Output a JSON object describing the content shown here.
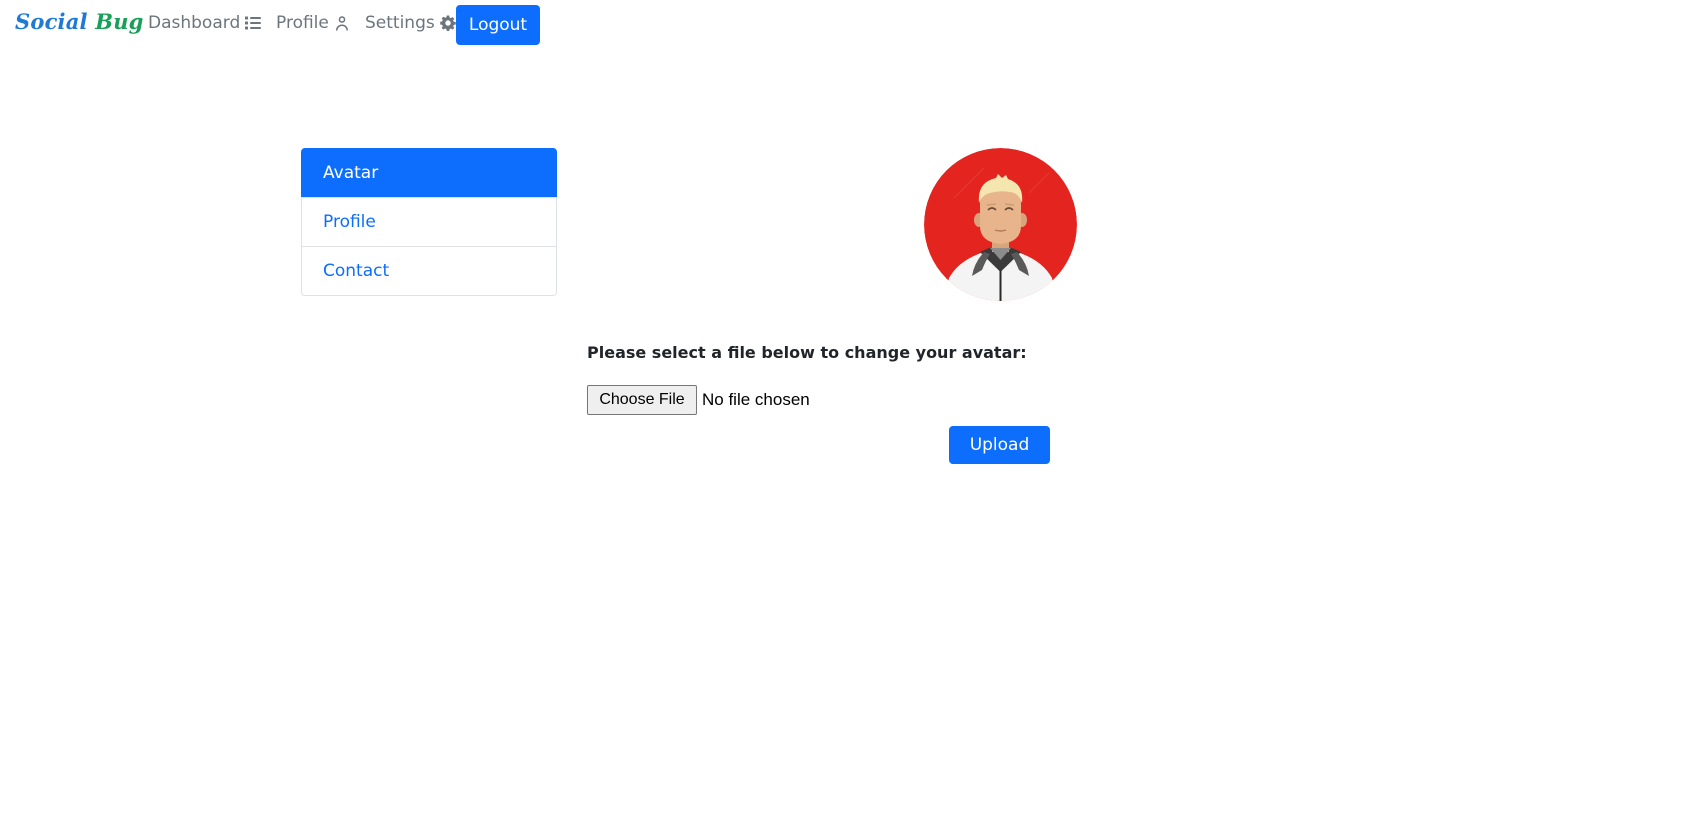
{
  "brand": {
    "part1": "Social",
    "part2": "Bug"
  },
  "nav": {
    "dashboard": {
      "label": "Dashboard",
      "icon": "list-icon"
    },
    "profile": {
      "label": "Profile",
      "icon": "user-icon"
    },
    "settings": {
      "label": "Settings",
      "icon": "gear-icon"
    },
    "logout": "Logout"
  },
  "sidebar": {
    "items": [
      {
        "label": "Avatar",
        "active": true
      },
      {
        "label": "Profile",
        "active": false
      },
      {
        "label": "Contact",
        "active": false
      }
    ]
  },
  "main": {
    "prompt": "Please select a file below to change your avatar:",
    "file_button": "Choose File",
    "file_status": "No file chosen",
    "upload_label": "Upload"
  },
  "colors": {
    "primary": "#0d6efd",
    "avatar_background": "#e3241f",
    "brand_blue": "#1f7ad6",
    "brand_green": "#18a058"
  }
}
